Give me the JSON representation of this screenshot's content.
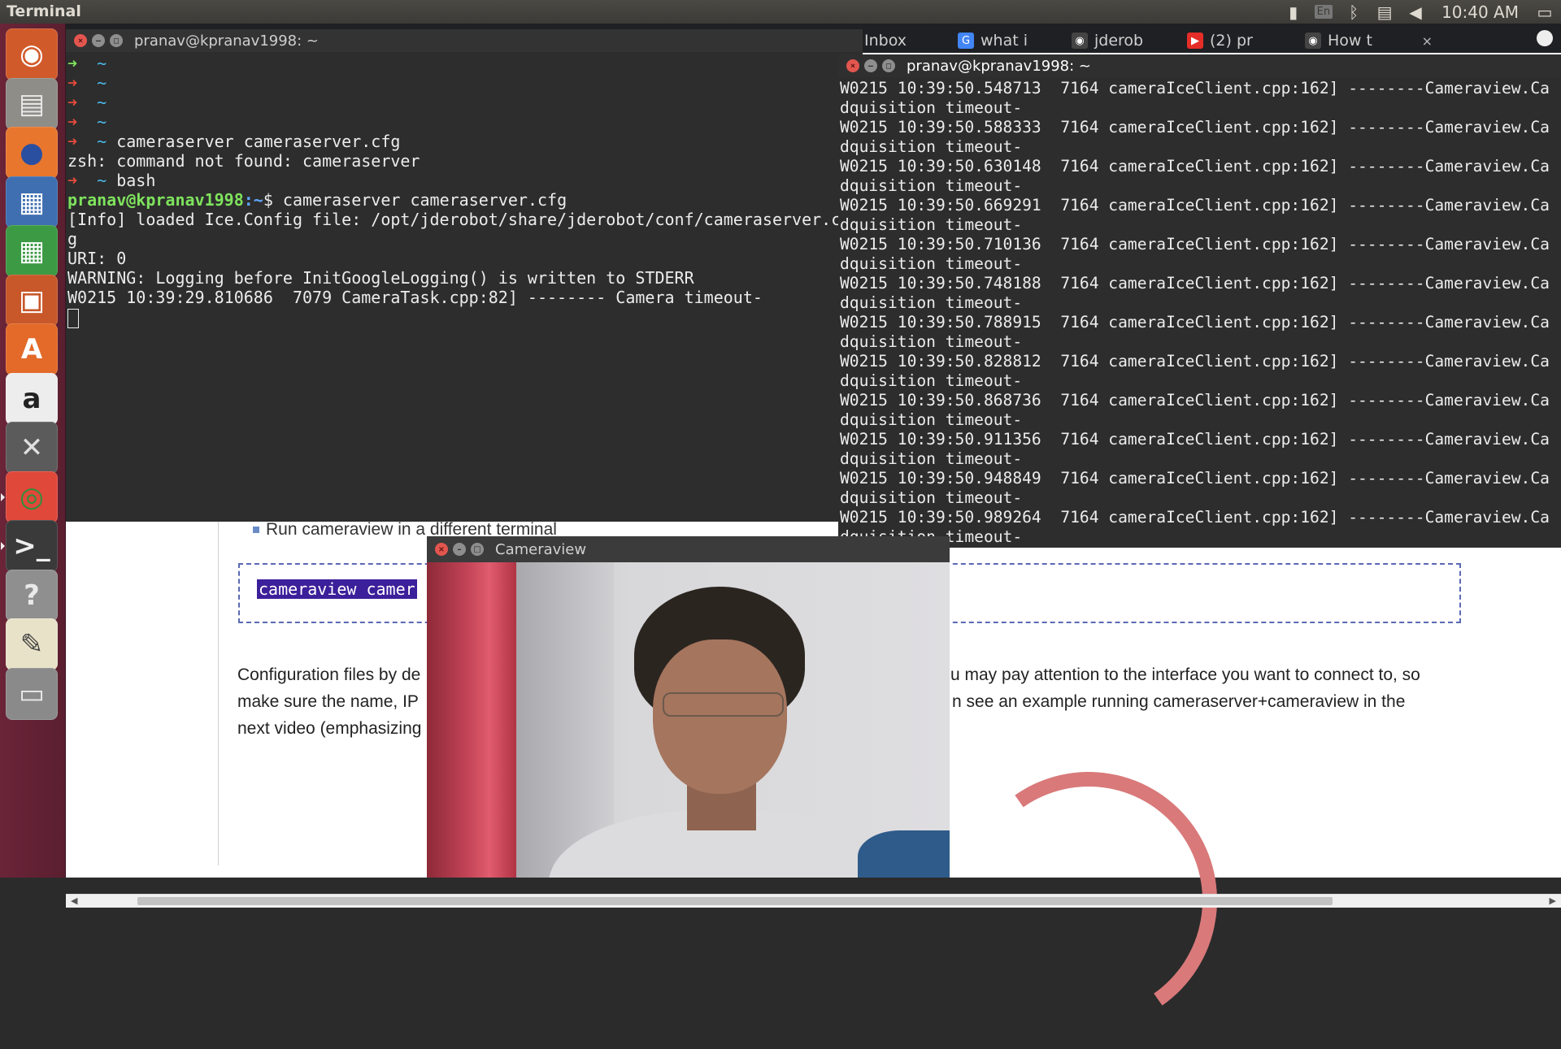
{
  "top_panel": {
    "title": "Terminal",
    "lang": "En",
    "clock": "10:40 AM",
    "icons": [
      "signal-icon",
      "keyboard-lang-icon",
      "bluetooth-icon",
      "clipboard-icon",
      "volume-icon",
      "display-icon"
    ]
  },
  "launcher": {
    "items": [
      {
        "name": "ubuntu-dash-icon",
        "glyph": "◉",
        "bg": "#d15a2a",
        "fg": "#ffffff"
      },
      {
        "name": "files-icon",
        "glyph": "▤",
        "bg": "#8e8d88",
        "fg": "#e9e9e9"
      },
      {
        "name": "firefox-icon",
        "glyph": "●",
        "bg": "#e8762d",
        "fg": "#2a4fa0"
      },
      {
        "name": "writer-icon",
        "glyph": "▦",
        "bg": "#3f6fb0",
        "fg": "#ffffff"
      },
      {
        "name": "calc-icon",
        "glyph": "▦",
        "bg": "#3c9a44",
        "fg": "#ffffff"
      },
      {
        "name": "impress-icon",
        "glyph": "▣",
        "bg": "#c8572a",
        "fg": "#ffffff"
      },
      {
        "name": "software-center-icon",
        "glyph": "A",
        "bg": "#e36a29",
        "fg": "#ffffff"
      },
      {
        "name": "amazon-icon",
        "glyph": "a",
        "bg": "#ededed",
        "fg": "#222222"
      },
      {
        "name": "system-settings-icon",
        "glyph": "✕",
        "bg": "#5b5b5b",
        "fg": "#e0e0e0"
      },
      {
        "name": "chrome-icon",
        "glyph": "◎",
        "bg": "#e0483a",
        "fg": "#2f8f3c"
      },
      {
        "name": "terminal-icon",
        "glyph": ">_",
        "bg": "#3a3a3a",
        "fg": "#eeeeee"
      },
      {
        "name": "help-icon",
        "glyph": "?",
        "bg": "#8f8f8f",
        "fg": "#e9e9e9"
      },
      {
        "name": "text-editor-icon",
        "glyph": "✎",
        "bg": "#e8e2c8",
        "fg": "#444444"
      },
      {
        "name": "workspace-switcher-icon",
        "glyph": "▭",
        "bg": "#8a8a8a",
        "fg": "#e9e9e9"
      }
    ]
  },
  "browser": {
    "tabs": [
      {
        "label": "",
        "icon": "",
        "color": "#1f2023"
      },
      {
        "label": "Inbox",
        "icon": "M",
        "color": "#d44638"
      },
      {
        "label": "what i",
        "icon": "G",
        "color": "#4285f4"
      },
      {
        "label": "jderob",
        "icon": "◉",
        "color": "#444444"
      },
      {
        "label": "(2) pr",
        "icon": "▶",
        "color": "#e52d27"
      },
      {
        "label": "How t",
        "icon": "◉",
        "color": "#444444"
      }
    ],
    "bullet": "Run cameraview in a different terminal",
    "code_snippet": "cameraview camer",
    "para_left": [
      "Configuration files by de",
      "make sure the name, IP",
      "next video (emphasizing"
    ],
    "para_right": [
      "u may pay attention to the interface you want to connect to, so",
      "n see an example running cameraserver+cameraview in the"
    ]
  },
  "term_left": {
    "title": "pranav@kpranav1998: ~",
    "lines": [
      {
        "arrow": "green",
        "tilde": "~",
        "text": ""
      },
      {
        "arrow": "red",
        "tilde": "~",
        "text": ""
      },
      {
        "arrow": "red",
        "tilde": "~",
        "text": ""
      },
      {
        "arrow": "red",
        "tilde": "~",
        "text": ""
      },
      {
        "arrow": "red",
        "tilde": "~",
        "text": " cameraserver cameraserver.cfg"
      },
      {
        "plain": "zsh: command not found: cameraserver"
      },
      {
        "arrow": "red",
        "tilde": "~",
        "text": " bash"
      },
      {
        "bash_user": "pranav@kpranav1998",
        "bash_path": ":~",
        "bash_text": "$ cameraserver cameraserver.cfg"
      },
      {
        "plain": "[Info] loaded Ice.Config file: /opt/jderobot/share/jderobot/conf/cameraserver.c"
      },
      {
        "plain": "g"
      },
      {
        "plain": "URI: 0"
      },
      {
        "plain": "WARNING: Logging before InitGoogleLogging() is written to STDERR"
      },
      {
        "plain": "W0215 10:39:29.810686  7079 CameraTask.cpp:82] -------- Camera timeout-"
      }
    ]
  },
  "term_right": {
    "title": "pranav@kpranav1998: ~",
    "lines": [
      "W0215 10:39:50.548713  7164 cameraIceClient.cpp:162] --------Cameraview.Ca",
      "dquisition timeout-",
      "W0215 10:39:50.588333  7164 cameraIceClient.cpp:162] --------Cameraview.Ca",
      "dquisition timeout-",
      "W0215 10:39:50.630148  7164 cameraIceClient.cpp:162] --------Cameraview.Ca",
      "dquisition timeout-",
      "W0215 10:39:50.669291  7164 cameraIceClient.cpp:162] --------Cameraview.Ca",
      "dquisition timeout-",
      "W0215 10:39:50.710136  7164 cameraIceClient.cpp:162] --------Cameraview.Ca",
      "dquisition timeout-",
      "W0215 10:39:50.748188  7164 cameraIceClient.cpp:162] --------Cameraview.Ca",
      "dquisition timeout-",
      "W0215 10:39:50.788915  7164 cameraIceClient.cpp:162] --------Cameraview.Ca",
      "dquisition timeout-",
      "W0215 10:39:50.828812  7164 cameraIceClient.cpp:162] --------Cameraview.Ca",
      "dquisition timeout-",
      "W0215 10:39:50.868736  7164 cameraIceClient.cpp:162] --------Cameraview.Ca",
      "dquisition timeout-",
      "W0215 10:39:50.911356  7164 cameraIceClient.cpp:162] --------Cameraview.Ca",
      "dquisition timeout-",
      "W0215 10:39:50.948849  7164 cameraIceClient.cpp:162] --------Cameraview.Ca",
      "dquisition timeout-",
      "W0215 10:39:50.989264  7164 cameraIceClient.cpp:162] --------Cameraview.Ca",
      "dquisition timeout-"
    ]
  },
  "cameraview": {
    "title": "Cameraview"
  }
}
